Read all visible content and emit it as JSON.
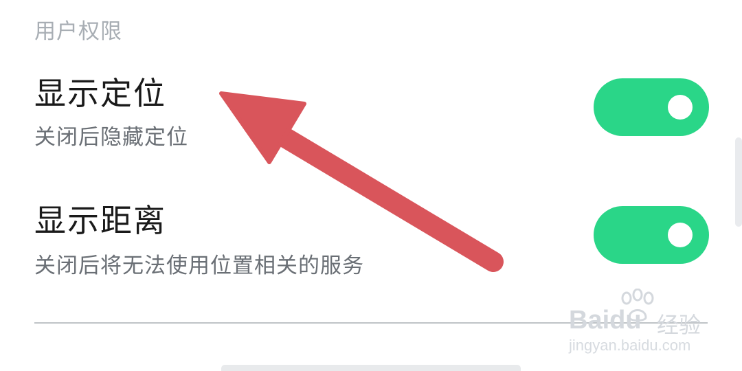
{
  "section": {
    "header": "用户权限"
  },
  "settings": [
    {
      "title": "显示定位",
      "description": "关闭后隐藏定位",
      "enabled": true
    },
    {
      "title": "显示距离",
      "description": "关闭后将无法使用位置相关的服务",
      "enabled": true
    }
  ],
  "colors": {
    "toggle_on": "#2ad688",
    "arrow": "#d9555b",
    "title_text": "#1a1a1a",
    "secondary_text": "#6a6f75",
    "header_text": "#a8aeb4"
  },
  "watermark": {
    "brand": "Baidu",
    "brand_cn": "经验",
    "url": "jingyan.baidu.com"
  },
  "icons": {
    "annotation": "arrow-annotation-icon",
    "watermark_logo": "baidu-paw-icon"
  }
}
